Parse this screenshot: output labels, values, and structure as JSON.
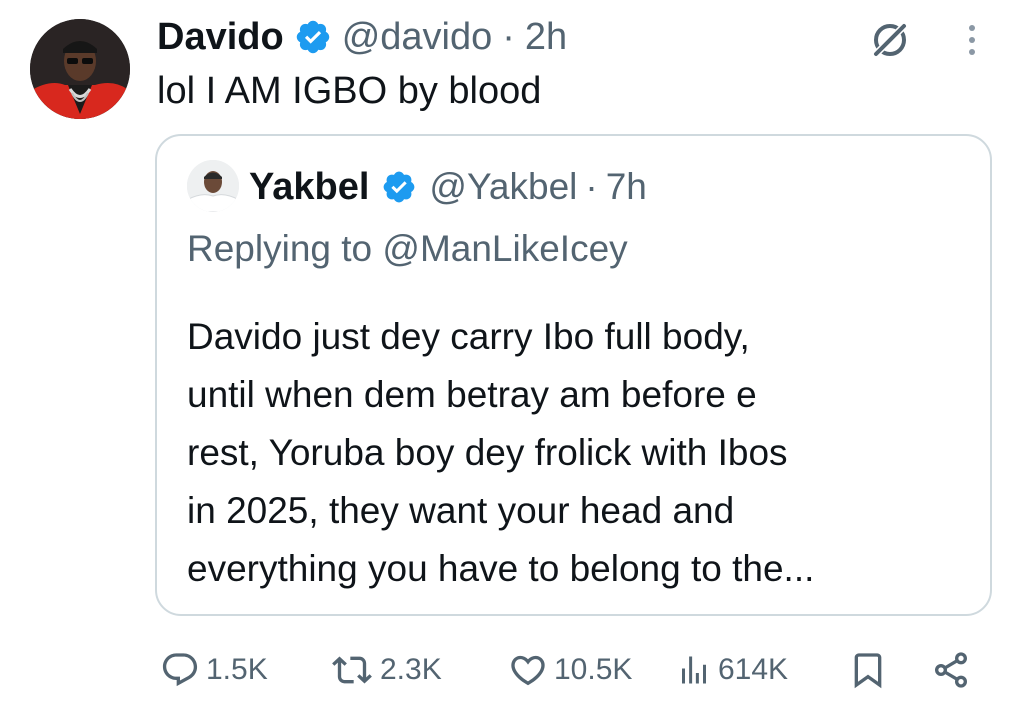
{
  "tweet": {
    "author_name": "Davido",
    "handle": "@davido",
    "separator": "·",
    "time": "2h",
    "text": "lol I AM IGBO by blood",
    "verified": true
  },
  "quoted": {
    "author_name": "Yakbel",
    "handle": "@Yakbel",
    "separator": "·",
    "time": "7h",
    "replying_to": "Replying to @ManLikeIcey",
    "verified": true,
    "text_lines": [
      "Davido just dey carry Ibo full body,",
      "until when dem betray am before e",
      "rest, Yoruba boy dey frolick with Ibos",
      "in 2025, they want your head and",
      "everything you have to belong to the..."
    ]
  },
  "actions": {
    "replies": "1.5K",
    "reposts": "2.3K",
    "likes": "10.5K",
    "views": "614K"
  },
  "icons": {
    "header": [
      "grok-icon",
      "more-options-icon",
      "verified-badge-icon"
    ],
    "actions": [
      "reply-icon",
      "repost-icon",
      "like-icon",
      "views-icon",
      "bookmark-icon",
      "share-icon"
    ]
  },
  "colors": {
    "verified_blue": "#1d9bf0",
    "text_primary": "#0f1419",
    "text_secondary": "#536471",
    "border": "#cfd9de"
  }
}
